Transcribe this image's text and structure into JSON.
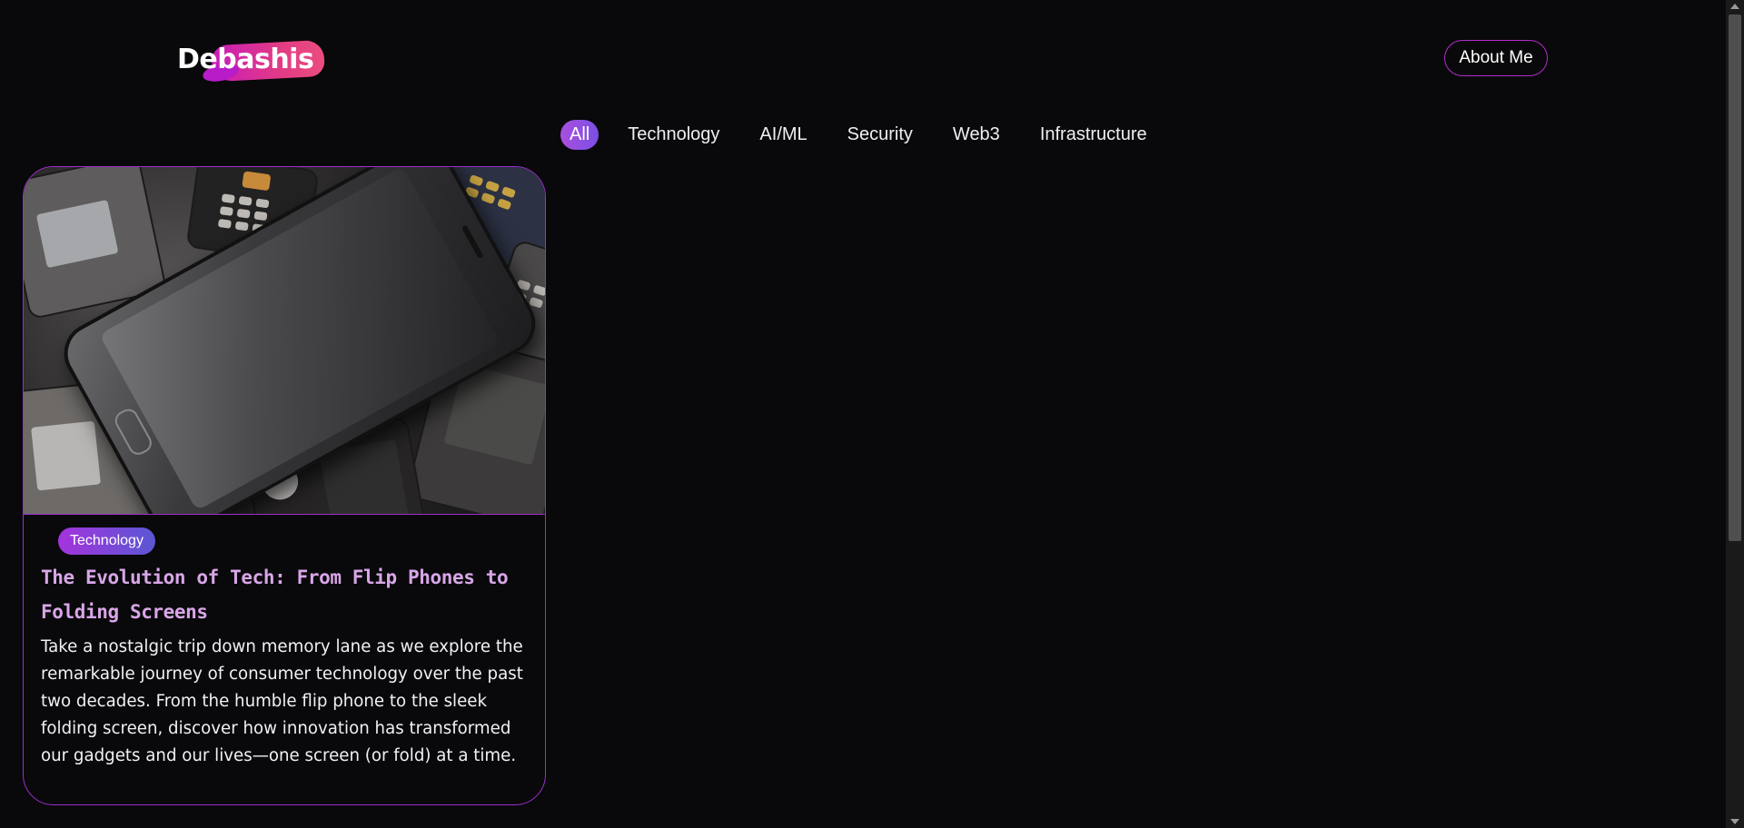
{
  "header": {
    "logo_text": "Debashis",
    "about_label": "About Me"
  },
  "filters": [
    "All",
    "Technology",
    "AI/ML",
    "Security",
    "Web3",
    "Infrastructure"
  ],
  "active_filter": "All",
  "colors": {
    "background": "#09080a",
    "accent_border": "#9b2fcf",
    "active_filter_gradient_start": "#a94fe0",
    "active_filter_gradient_end": "#7a4fe3",
    "title_color": "#d8a6e8",
    "logo_gradient_start": "#c71cb8",
    "logo_gradient_end": "#ea4d7e"
  },
  "posts": [
    {
      "image_subject": "pile-of-old-mobile-phones",
      "tag": "Technology",
      "title": "The Evolution of Tech: From Flip Phones to Folding Screens",
      "description": "Take a nostalgic trip down memory lane as we explore the remarkable journey of consumer technology over the past two decades. From the humble flip phone to the sleek folding screen, discover how innovation has transformed our gadgets and our lives—one screen (or fold) at a time."
    }
  ]
}
